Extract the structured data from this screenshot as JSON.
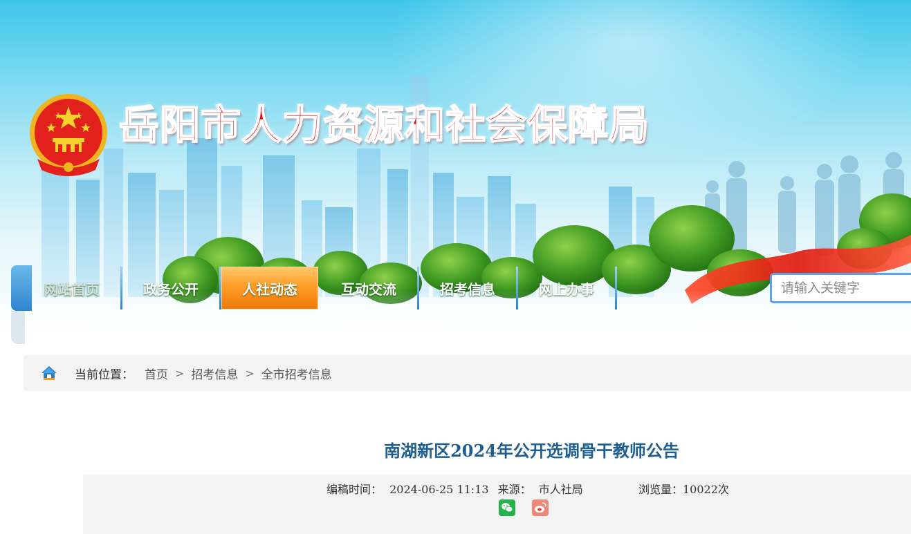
{
  "site": {
    "title": "岳阳市人力资源和社会保障局"
  },
  "nav": {
    "items": [
      {
        "label": "网站首页"
      },
      {
        "label": "政务公开"
      },
      {
        "label": "人社动态"
      },
      {
        "label": "互动交流"
      },
      {
        "label": "招考信息"
      },
      {
        "label": "网上办事"
      }
    ],
    "active": "人社动态"
  },
  "search": {
    "placeholder": "请输入关键字"
  },
  "breadcrumb": {
    "label": "当前位置：",
    "items": [
      "首页",
      "招考信息",
      "全市招考信息"
    ],
    "separator": ">"
  },
  "article": {
    "title": "南湖新区2024年公开选调骨干教师公告",
    "date_label": "编稿时间：",
    "date": "2024-06-25 11:13",
    "source_label": "来源：",
    "source": "市人社局",
    "views_label": "浏览量：",
    "views": "10022次"
  },
  "share": [
    "wechat-icon",
    "weibo-icon"
  ],
  "colors": {
    "title_red": "#e0141b",
    "nav_active": "#ff9d28",
    "article_title": "#1d5e91",
    "crumb_bg": "#f3f3f3"
  }
}
